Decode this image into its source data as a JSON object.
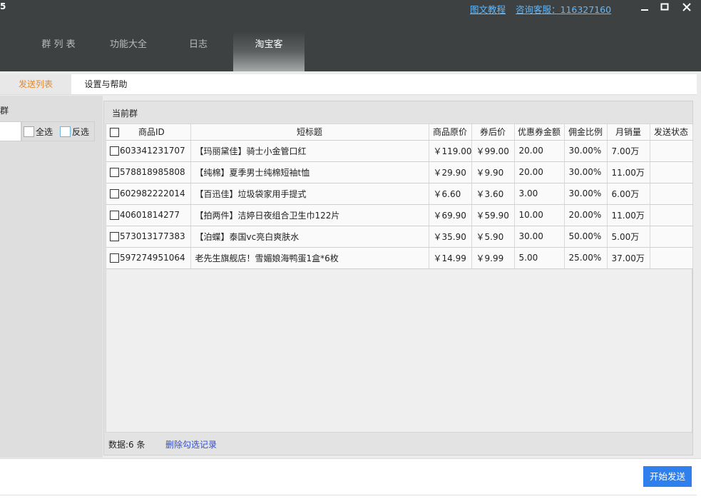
{
  "titlebar": {
    "app_title_fragment": "5",
    "links": {
      "tutorial": "图文教程",
      "support": "咨询客服：116327160"
    },
    "icons": [
      "minimize-icon",
      "maximize-icon",
      "close-icon"
    ]
  },
  "nav": {
    "tabs": [
      "群 列 表",
      "功能大全",
      "日志",
      "淘宝客"
    ],
    "active": "淘宝客"
  },
  "subtabs": {
    "items": [
      "发送列表",
      "设置与帮助"
    ],
    "active": "发送列表"
  },
  "left": {
    "title_fragment": "群",
    "select_all": "全选",
    "invert": "反选"
  },
  "main": {
    "group_title": "当前群",
    "columns": [
      "商品ID",
      "短标题",
      "商品原价",
      "券后价",
      "优惠券金额",
      "佣金比例",
      "月销量",
      "发送状态"
    ],
    "rows": [
      {
        "id": "603341231707",
        "title": "【玛丽黛佳】骑士小金管口红",
        "price": "￥119.00",
        "after": "￥99.00",
        "coupon": "20.00",
        "commission": "30.00%",
        "sales": "7.00万",
        "status": ""
      },
      {
        "id": "578818985808",
        "title": "【纯棉】夏季男士纯棉短袖t恤",
        "price": "￥29.90",
        "after": "￥9.90",
        "coupon": "20.00",
        "commission": "30.00%",
        "sales": "11.00万",
        "status": ""
      },
      {
        "id": "602982222014",
        "title": "【百迅佳】垃圾袋家用手提式",
        "price": "￥6.60",
        "after": "￥3.60",
        "coupon": "3.00",
        "commission": "30.00%",
        "sales": "6.00万",
        "status": ""
      },
      {
        "id": "40601814277",
        "title": "【拍两件】洁婷日夜组合卫生巾122片",
        "price": "￥69.90",
        "after": "￥59.90",
        "coupon": "10.00",
        "commission": "20.00%",
        "sales": "11.00万",
        "status": ""
      },
      {
        "id": "573013177383",
        "title": "【泊蝶】泰国vc亮白爽肤水",
        "price": "￥35.90",
        "after": "￥5.90",
        "coupon": "30.00",
        "commission": "50.00%",
        "sales": "5.00万",
        "status": ""
      },
      {
        "id": "597274951064",
        "title": "老先生旗舰店！雪媚娘海鸭蛋1盒*6枚",
        "price": "￥14.99",
        "after": "￥9.99",
        "coupon": "5.00",
        "commission": "25.00%",
        "sales": "37.00万",
        "status": ""
      }
    ],
    "count_text": "数据:6 条",
    "delete_link": "删除勾选记录"
  },
  "actions": {
    "start_send": "开始发送"
  },
  "colors": {
    "titlebar": "#3d4142",
    "active_subtab": "#e08a2f",
    "link": "#5fb9ff",
    "button": "#2f80ed"
  }
}
